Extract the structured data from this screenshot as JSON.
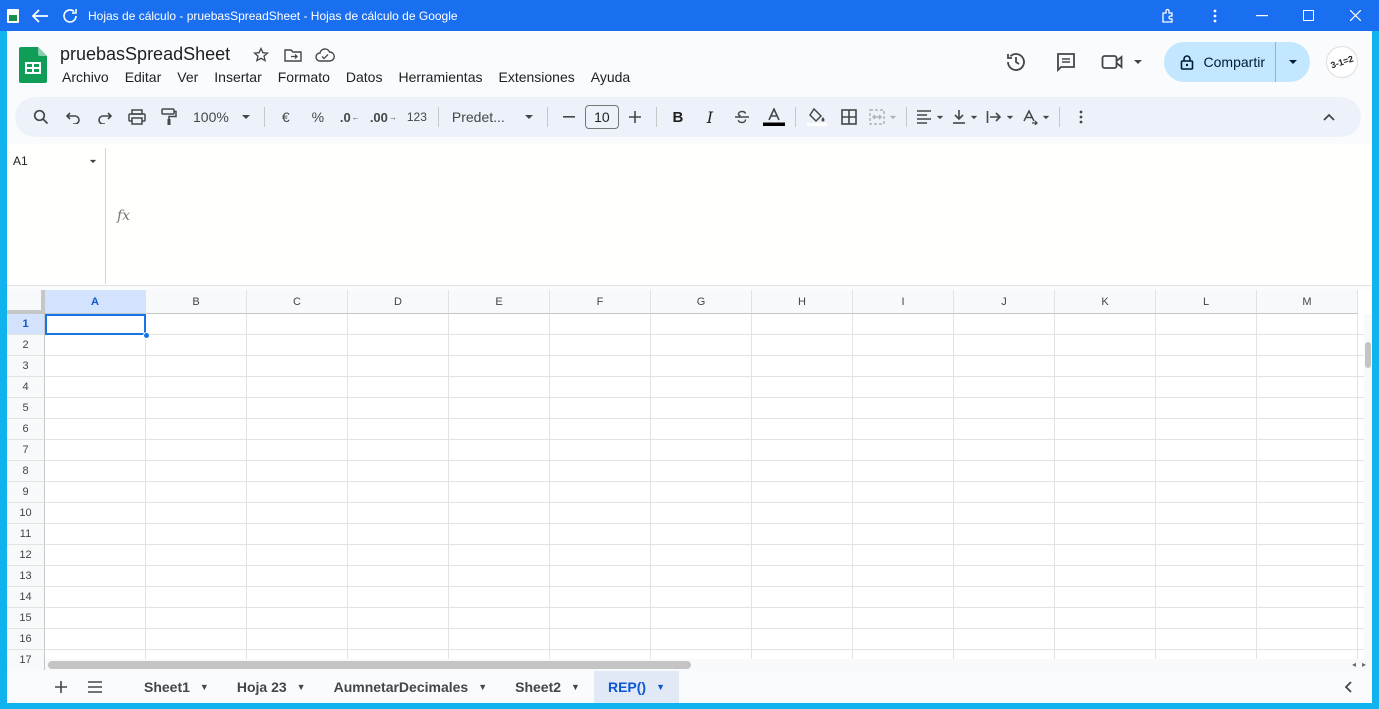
{
  "window": {
    "title": "Hojas de cálculo - pruebasSpreadSheet - Hojas de cálculo de Google",
    "titlebar_color": "#1a6ef0",
    "border_color": "#11b3ee"
  },
  "doc": {
    "title": "pruebasSpreadSheet"
  },
  "menu": [
    "Archivo",
    "Editar",
    "Ver",
    "Insertar",
    "Formato",
    "Datos",
    "Herramientas",
    "Extensiones",
    "Ayuda"
  ],
  "share": {
    "label": "Compartir",
    "color": "#c2e7ff"
  },
  "avatar": {
    "text": "3-1=2"
  },
  "toolbar": {
    "zoom": "100%",
    "currency": "€",
    "percent": "%",
    "dec_decrease": ".0",
    "dec_increase": ".00",
    "format_123": "123",
    "font": "Predet...",
    "font_size": "10",
    "bold": "B",
    "italic": "I"
  },
  "formula_bar": {
    "name_box": "A1",
    "fx": "fx",
    "value": ""
  },
  "grid": {
    "columns": [
      "A",
      "B",
      "C",
      "D",
      "E",
      "F",
      "G",
      "H",
      "I",
      "J",
      "K",
      "L",
      "M"
    ],
    "rows": [
      "1",
      "2",
      "3",
      "4",
      "5",
      "6",
      "7",
      "8",
      "9",
      "10",
      "11",
      "12",
      "13",
      "14",
      "15",
      "16",
      "17"
    ],
    "selected_cell": "A1"
  },
  "sheets": [
    {
      "name": "Sheet1",
      "active": false
    },
    {
      "name": "Hoja 23",
      "active": false
    },
    {
      "name": "AumnetarDecimales",
      "active": false
    },
    {
      "name": "Sheet2",
      "active": false
    },
    {
      "name": "REP()",
      "active": true
    }
  ],
  "colors": {
    "accent": "#0b57d0",
    "selection": "#1a73e8",
    "sheets_green": "#0f9d58"
  }
}
